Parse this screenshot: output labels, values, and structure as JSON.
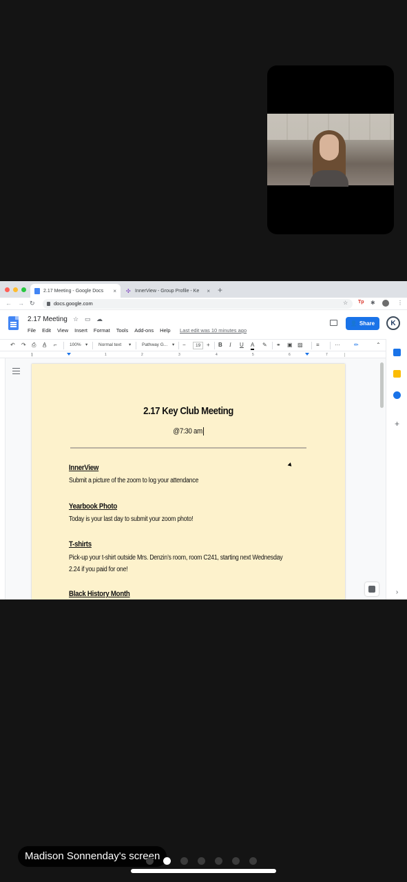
{
  "browser": {
    "tabs": [
      {
        "label": "2.17 Meeting - Google Docs",
        "close": "×"
      },
      {
        "label": "InnerView - Group Profile - Ke",
        "close": "×"
      }
    ],
    "new_tab": "+",
    "url": "docs.google.com"
  },
  "docs": {
    "title": "2.17 Meeting",
    "menu": [
      "File",
      "Edit",
      "View",
      "Insert",
      "Format",
      "Tools",
      "Add-ons",
      "Help"
    ],
    "last_edit": "Last edit was 10 minutes ago",
    "share_label": "Share",
    "avatar_letter": "K",
    "toolbar": {
      "zoom": "100%",
      "style": "Normal text",
      "font": "Pathway G...",
      "font_size": "19",
      "bold": "B",
      "italic": "I",
      "underline": "U",
      "text_color": "A",
      "more": "···"
    },
    "ruler_numbers": [
      "1",
      "1",
      "2",
      "3",
      "4",
      "5",
      "6",
      "7"
    ]
  },
  "document": {
    "title": "2.17 Key Club Meeting",
    "time": "@7:30 am",
    "sections": [
      {
        "heading": "InnerView",
        "lines": [
          "Submit a picture of the zoom to log your attendance"
        ]
      },
      {
        "heading": "Yearbook Photo",
        "lines": [
          "Today is your last day to submit your zoom photo!"
        ]
      },
      {
        "heading": "T-shirts",
        "lines": [
          "Pick-up your t-shirt outside Mrs. Denzin’s room, room C241, starting next Wednesday",
          "2.24 if you paid for one!"
        ]
      },
      {
        "heading": "Black History Month",
        "lines": []
      }
    ]
  },
  "zoom": {
    "sharer_label": "Madison Sonnenday's screen",
    "page_count": 7,
    "active_page": 2
  },
  "colors": {
    "page_background": "#fdf2cc",
    "share_button": "#1a73e8",
    "app_background": "#141414"
  }
}
